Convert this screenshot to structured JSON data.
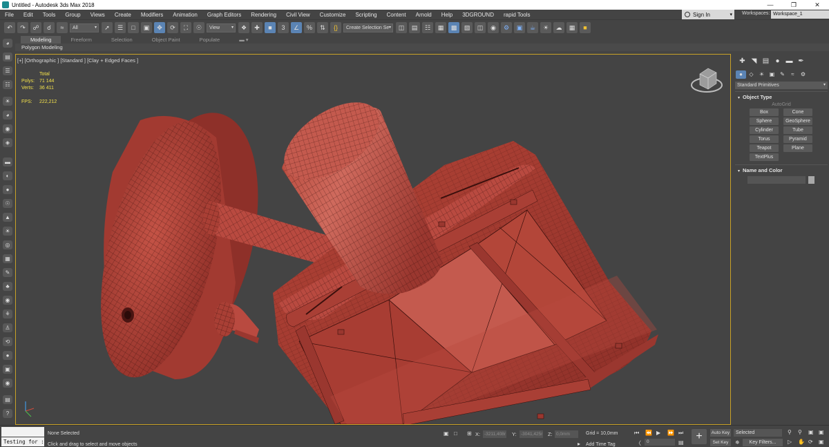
{
  "window": {
    "title": "Untitled - Autodesk 3ds Max 2018",
    "minimize": "—",
    "maximize": "❐",
    "close": "✕"
  },
  "menu": {
    "items": [
      "File",
      "Edit",
      "Tools",
      "Group",
      "Views",
      "Create",
      "Modifiers",
      "Animation",
      "Graph Editors",
      "Rendering",
      "Civil View",
      "Customize",
      "Scripting",
      "Content",
      "Arnold",
      "Help",
      "3DGROUND",
      "rapid Tools"
    ],
    "sign_in": "Sign In",
    "workspaces_label": "Workspaces:",
    "workspace_value": "Workspace_1"
  },
  "toolbar": {
    "filter_value": "All",
    "view_value": "View",
    "selection_set_placeholder": "Create Selection Se",
    "snap_label": "3",
    "percent_label": "%"
  },
  "ribbon": {
    "tabs": [
      "Modeling",
      "Freeform",
      "Selection",
      "Object Paint",
      "Populate"
    ],
    "active_tab": "Modeling",
    "sub_label": "Polygon Modeling"
  },
  "viewport": {
    "label": "[+] [Orthographic ] [Standard ] [Clay + Edged Faces ]",
    "stats": {
      "total_label": "Total",
      "polys_label": "Polys:",
      "polys_value": "71 144",
      "verts_label": "Verts:",
      "verts_value": "36 411",
      "fps_label": "FPS:",
      "fps_value": "222,212"
    },
    "colors": {
      "background": "#444444",
      "mesh_fill": "#b94a40",
      "mesh_shadow": "#8e3029",
      "mesh_light": "#c95c50",
      "wire": "#3a0f0c",
      "frame": "#c9a227"
    }
  },
  "command_panel": {
    "category": "Standard Primitives",
    "object_type_title": "Object Type",
    "autogrid_label": "AutoGrid",
    "primitives": [
      "Box",
      "Cone",
      "Sphere",
      "GeoSphere",
      "Cylinder",
      "Tube",
      "Torus",
      "Pyramid",
      "Teapot",
      "Plane",
      "TextPlus"
    ],
    "name_color_title": "Name and Color"
  },
  "status": {
    "maxscript_text": "Testing for :",
    "selection": "None Selected",
    "prompt": "Click and drag to select and move objects",
    "x_label": "X:",
    "x_value": "-3211,408r",
    "y_label": "Y:",
    "y_value": "-3041,425r",
    "z_label": "Z:",
    "z_value": "0,0mm",
    "grid": "Grid = 10,0mm",
    "add_time_tag": "Add Time Tag",
    "frame_value": "0",
    "auto_key": "Auto Key",
    "set_key": "Set Key",
    "selected_dropdown": "Selected",
    "key_filters": "Key Filters..."
  }
}
